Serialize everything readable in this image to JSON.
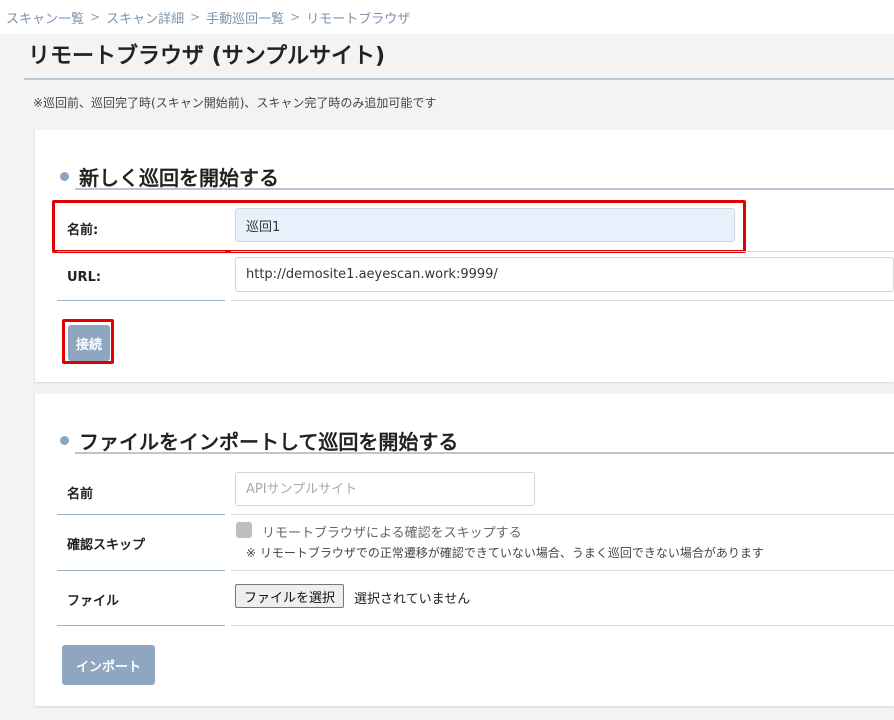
{
  "breadcrumb": {
    "items": [
      "スキャン一覧",
      "スキャン詳細",
      "手動巡回一覧",
      "リモートブラウザ"
    ],
    "separator": ">"
  },
  "page": {
    "title": "リモートブラウザ (サンプルサイト)",
    "note": "※巡回前、巡回完了時(スキャン開始前)、スキャン完了時のみ追加可能です"
  },
  "new_crawl": {
    "title": "新しく巡回を開始する",
    "name_label": "名前:",
    "name_value": "巡回1",
    "url_label": "URL:",
    "url_value": "http://demosite1.aeyescan.work:9999/",
    "connect_label": "接続"
  },
  "import_crawl": {
    "title": "ファイルをインポートして巡回を開始する",
    "name_label": "名前",
    "name_placeholder": "APIサンプルサイト",
    "skip_label": "確認スキップ",
    "skip_checkbox_text": "リモートブラウザによる確認をスキップする",
    "skip_note": "※ リモートブラウザでの正常遷移が確認できていない場合、うまく巡回できない場合があります",
    "file_label": "ファイル",
    "file_button": "ファイルを選択",
    "file_status": "選択されていません",
    "import_label": "インポート"
  },
  "colors": {
    "accent": "#8ea6bf",
    "highlight": "#e00000",
    "input_filled": "#e8f0fc"
  }
}
